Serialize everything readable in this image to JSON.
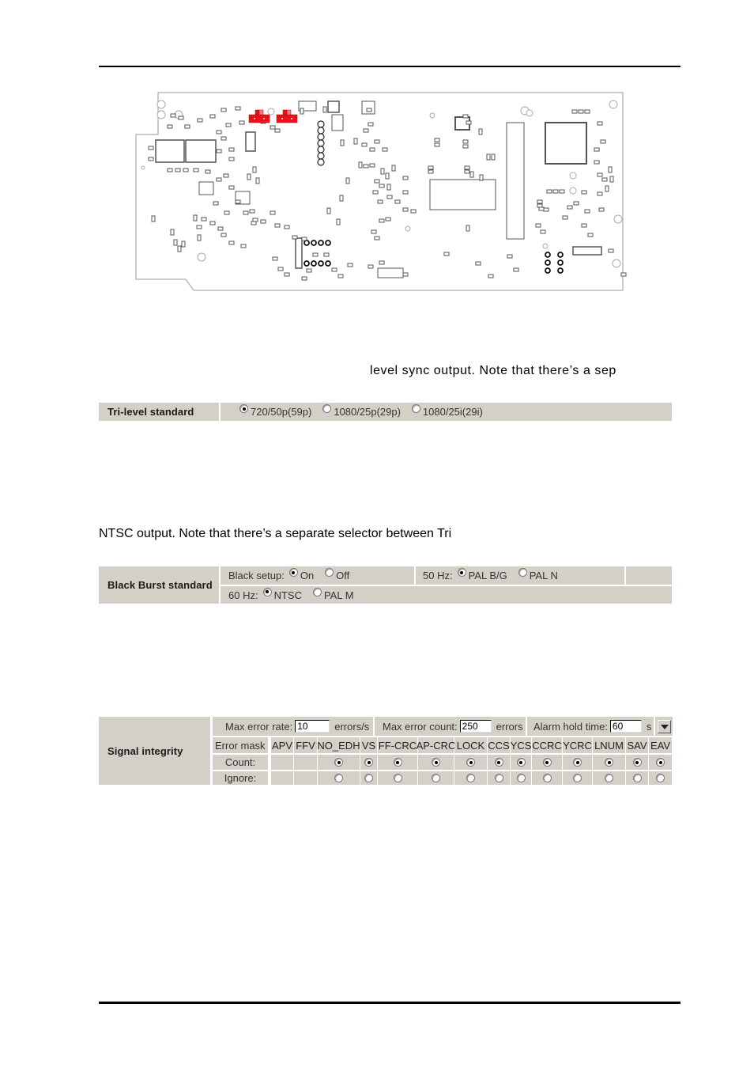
{
  "document": {
    "paragraph_fragment_1": "level sync output. Note that there’s a sep",
    "paragraph_fragment_2": "NTSC output. Note that there’s a separate selector between Tri"
  },
  "pcb_diagram": {
    "description": "PCB component layout board diagram",
    "highlight_color": "#e8131a",
    "highlighted_components": [
      "jumper-1",
      "jumper-2"
    ]
  },
  "tri_level": {
    "label": "Tri-level standard",
    "options": [
      {
        "label": "720/50p(59p)",
        "selected": true
      },
      {
        "label": "1080/25p(29p)",
        "selected": false
      },
      {
        "label": "1080/25i(29i)",
        "selected": false
      }
    ]
  },
  "black_burst": {
    "label": "Black Burst standard",
    "black_setup": {
      "label": "Black setup:",
      "options": [
        {
          "label": "On",
          "selected": true
        },
        {
          "label": "Off",
          "selected": false
        }
      ]
    },
    "hz50": {
      "label": "50 Hz:",
      "options": [
        {
          "label": "PAL B/G",
          "selected": true
        },
        {
          "label": "PAL N",
          "selected": false
        }
      ]
    },
    "hz60": {
      "label": "60 Hz:",
      "options": [
        {
          "label": "NTSC",
          "selected": true
        },
        {
          "label": "PAL M",
          "selected": false
        }
      ]
    }
  },
  "signal_integrity": {
    "label": "Signal integrity",
    "max_error_rate": {
      "label": "Max error rate:",
      "value": "10",
      "unit": "errors/s"
    },
    "max_error_count": {
      "label": "Max error count:",
      "value": "250",
      "unit": "errors"
    },
    "alarm_hold_time": {
      "label": "Alarm hold time:",
      "value": "60",
      "unit": "s"
    },
    "error_mask_label": "Error mask",
    "count_label": "Count:",
    "ignore_label": "Ignore:",
    "columns": [
      "APV",
      "FFV",
      "NO_EDH",
      "VS",
      "FF-CRC",
      "AP-CRC",
      "LOCK",
      "CCS",
      "YCS",
      "CCRC",
      "YCRC",
      "LNUM",
      "SAV",
      "EAV"
    ],
    "count_selected": [
      null,
      null,
      true,
      true,
      true,
      true,
      true,
      true,
      true,
      true,
      true,
      true,
      true,
      true
    ]
  }
}
